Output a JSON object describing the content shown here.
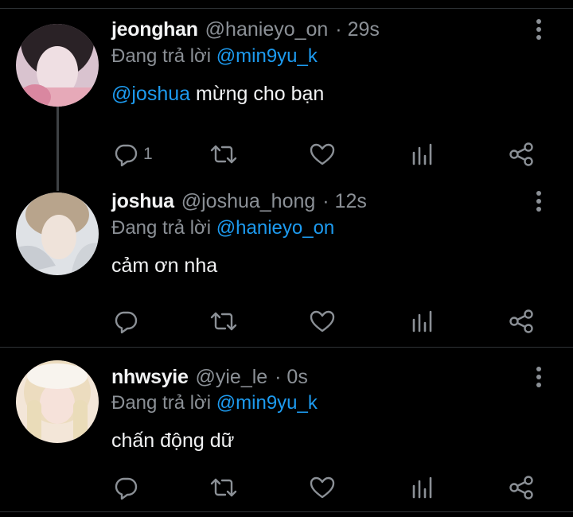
{
  "colors": {
    "background": "#000000",
    "text": "#e7e9ea",
    "muted": "#8b9096",
    "mention": "#1d9bf0",
    "divider": "#2f3336"
  },
  "tweets": [
    {
      "name": "jeonghan",
      "handle": "@hanieyo_on",
      "time": "· 29s",
      "reply_prefix": "Đang trả lời",
      "reply_to": "@min9yu_k",
      "mention": "@joshua",
      "text": " mừng cho bạn",
      "reply_count": "1",
      "icons": [
        "reply-icon",
        "retweet-icon",
        "like-icon",
        "views-icon",
        "share-icon",
        "more-icon"
      ]
    },
    {
      "name": "joshua",
      "handle": "@joshua_hong",
      "time": "· 12s",
      "reply_prefix": "Đang trả lời",
      "reply_to": "@hanieyo_on",
      "mention": "",
      "text": "cảm ơn nha",
      "reply_count": "",
      "icons": [
        "reply-icon",
        "retweet-icon",
        "like-icon",
        "views-icon",
        "share-icon",
        "more-icon"
      ]
    },
    {
      "name": "nhwsyie",
      "handle": "@yie_le",
      "time": "· 0s",
      "reply_prefix": "Đang trả lời",
      "reply_to": "@min9yu_k",
      "mention": "",
      "text": "chấn động dữ",
      "reply_count": "",
      "icons": [
        "reply-icon",
        "retweet-icon",
        "like-icon",
        "views-icon",
        "share-icon",
        "more-icon"
      ]
    }
  ]
}
